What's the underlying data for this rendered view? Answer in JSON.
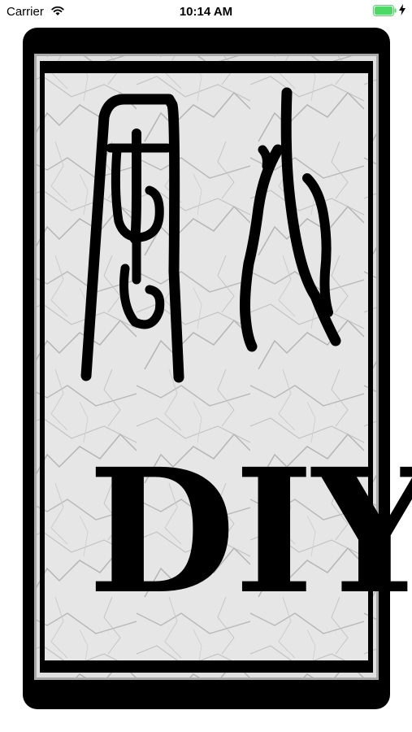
{
  "status_bar": {
    "carrier": "Carrier",
    "time": "10:14 AM",
    "wifi_icon": "wifi-icon",
    "battery_icon": "battery-full-icon",
    "charging_icon": "charging-bolt-icon",
    "battery_color": "#4cd964"
  },
  "splash": {
    "logo_glyphs": "風水",
    "logo_text": "DIY",
    "frame_color": "#000000",
    "background": "marble"
  }
}
